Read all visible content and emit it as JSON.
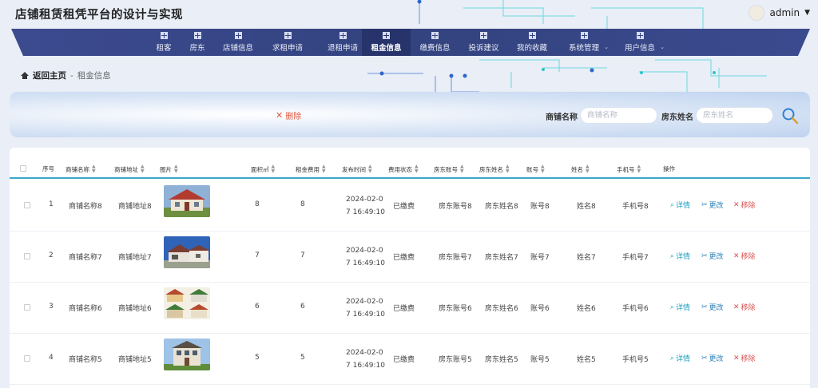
{
  "header": {
    "app_title": "店铺租赁租凭平台的设计与实现",
    "user": "admin"
  },
  "nav": [
    {
      "label": "租客",
      "active": false,
      "dropdown": false
    },
    {
      "label": "房东",
      "active": false,
      "dropdown": false
    },
    {
      "label": "店铺信息",
      "active": false,
      "dropdown": false
    },
    {
      "label": "求租申请",
      "active": false,
      "dropdown": false
    },
    {
      "label": "退租申请",
      "active": false,
      "dropdown": false
    },
    {
      "label": "租金信息",
      "active": true,
      "dropdown": false
    },
    {
      "label": "缴费信息",
      "active": false,
      "dropdown": false
    },
    {
      "label": "投诉建议",
      "active": false,
      "dropdown": false
    },
    {
      "label": "我的收藏",
      "active": false,
      "dropdown": false
    },
    {
      "label": "系统管理",
      "active": false,
      "dropdown": true
    },
    {
      "label": "用户信息",
      "active": false,
      "dropdown": true
    }
  ],
  "breadcrumb": {
    "home": "返回主页",
    "sep": "-",
    "current": "租金信息"
  },
  "search": {
    "delete_label": "删除",
    "shop_name_label": "商铺名称",
    "shop_name_placeholder": "商铺名称",
    "landlord_name_label": "房东姓名",
    "landlord_name_placeholder": "房东姓名"
  },
  "table": {
    "headers": [
      "序号",
      "商铺名称",
      "商铺地址",
      "图片",
      "面积㎡",
      "租金费用",
      "发布时间",
      "费用状态",
      "房东账号",
      "房东姓名",
      "账号",
      "姓名",
      "手机号",
      "操作"
    ],
    "rows": [
      {
        "index": "1",
        "shop_name": "商铺名称8",
        "address": "商铺地址8",
        "area": "8",
        "rent": "8",
        "time": "2024-02-07 16:49:10",
        "status": "已缴费",
        "landlord_account": "房东账号8",
        "landlord_name": "房东姓名8",
        "account": "账号8",
        "name": "姓名8",
        "phone": "手机号8",
        "image": "house-red"
      },
      {
        "index": "2",
        "shop_name": "商铺名称7",
        "address": "商铺地址7",
        "area": "7",
        "rent": "7",
        "time": "2024-02-07 16:49:10",
        "status": "已缴费",
        "landlord_account": "房东账号7",
        "landlord_name": "房东姓名7",
        "account": "账号7",
        "name": "姓名7",
        "phone": "手机号7",
        "image": "house-white"
      },
      {
        "index": "3",
        "shop_name": "商铺名称6",
        "address": "商铺地址6",
        "area": "6",
        "rent": "6",
        "time": "2024-02-07 16:49:10",
        "status": "已缴费",
        "landlord_account": "房东账号6",
        "landlord_name": "房东姓名6",
        "account": "账号6",
        "name": "姓名6",
        "phone": "手机号6",
        "image": "house-grid"
      },
      {
        "index": "4",
        "shop_name": "商铺名称5",
        "address": "商铺地址5",
        "area": "5",
        "rent": "5",
        "time": "2024-02-07 16:49:10",
        "status": "已缴费",
        "landlord_account": "房东账号5",
        "landlord_name": "房东姓名5",
        "account": "账号5",
        "name": "姓名5",
        "phone": "手机号5",
        "image": "house-villa"
      }
    ],
    "actions": {
      "detail": "详情",
      "edit": "更改",
      "remove": "移除"
    }
  },
  "colors": {
    "nav_bg": "#33437f",
    "nav_active": "#27346b",
    "accent": "#3aa8c9",
    "danger": "#d9534f"
  }
}
